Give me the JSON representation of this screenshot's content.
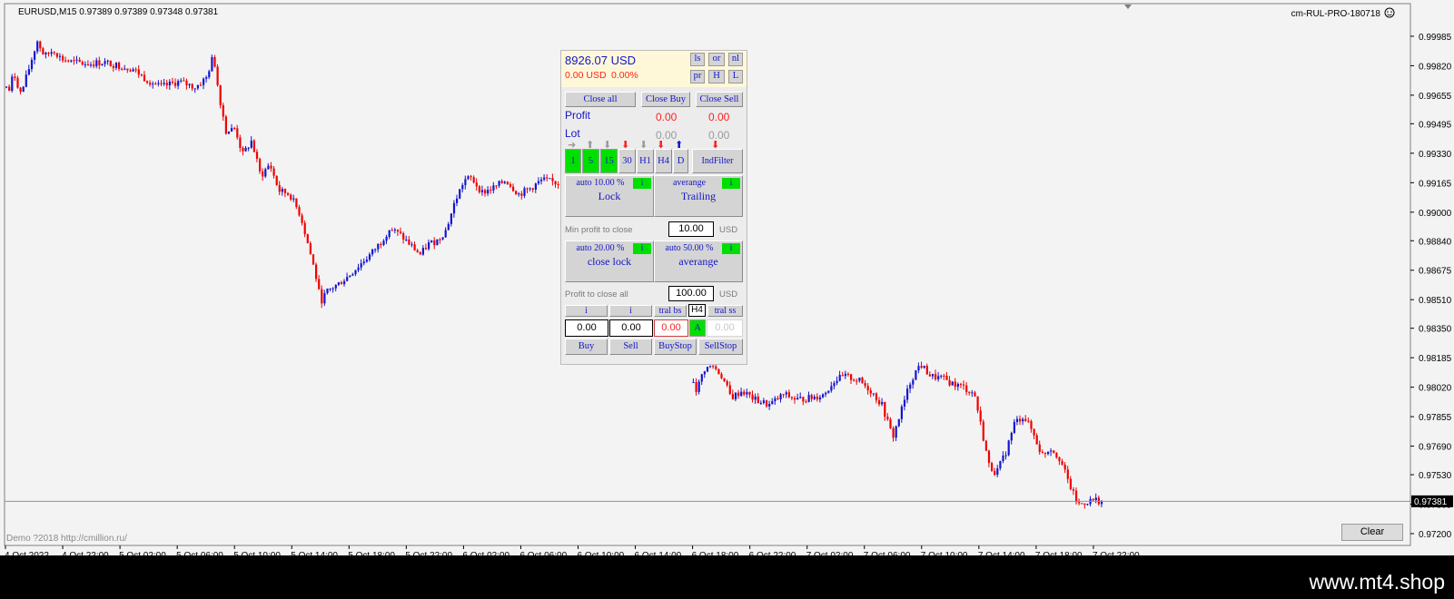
{
  "header": {
    "symbol_info": "EURUSD,M15  0.97389 0.97389 0.97348 0.97381",
    "indicator_name": "cm-RUL-PRO-180718"
  },
  "icons": {
    "smiley": "smiley-icon",
    "arrow_up": "arrow-up-icon",
    "arrow_down": "arrow-down-icon"
  },
  "colors": {
    "bull": "#1515d0",
    "bear": "#f00000",
    "panel_blue": "#1515c8",
    "active_green": "#00e000"
  },
  "chart_data": {
    "type": "candlestick",
    "symbol": "EURUSD",
    "timeframe": "M15",
    "ylim": [
      0.9721,
      1.0
    ],
    "y_ticks": [
      "0.99985",
      "0.99820",
      "0.99655",
      "0.99495",
      "0.99330",
      "0.99165",
      "0.99000",
      "0.98840",
      "0.98675",
      "0.98510",
      "0.98350",
      "0.98185",
      "0.98020",
      "0.97855",
      "0.97690",
      "0.97530",
      "0.97365",
      "0.97200"
    ],
    "x_ticks": [
      "4 Oct 2022",
      "4 Oct 22:00",
      "5 Oct 02:00",
      "5 Oct 06:00",
      "5 Oct 10:00",
      "5 Oct 14:00",
      "5 Oct 18:00",
      "5 Oct 22:00",
      "6 Oct 02:00",
      "6 Oct 06:00",
      "6 Oct 10:00",
      "6 Oct 14:00",
      "6 Oct 18:00",
      "6 Oct 22:00",
      "7 Oct 02:00",
      "7 Oct 06:00",
      "7 Oct 10:00",
      "7 Oct 14:00",
      "7 Oct 18:00",
      "7 Oct 22:00"
    ],
    "current_price": "0.97381",
    "price_path": [
      [
        0,
        0.9982
      ],
      [
        8,
        0.9966
      ],
      [
        14,
        0.9978
      ],
      [
        22,
        0.9966
      ],
      [
        30,
        0.9979
      ],
      [
        40,
        0.9996
      ],
      [
        48,
        0.9987
      ],
      [
        58,
        0.9991
      ],
      [
        66,
        0.9986
      ],
      [
        78,
        0.9984
      ],
      [
        96,
        0.9983
      ],
      [
        112,
        0.9984
      ],
      [
        130,
        0.9982
      ],
      [
        146,
        0.998
      ],
      [
        158,
        0.9975
      ],
      [
        176,
        0.997
      ],
      [
        196,
        0.9973
      ],
      [
        214,
        0.997
      ],
      [
        226,
        0.9975
      ],
      [
        234,
        0.9988
      ],
      [
        240,
        0.9966
      ],
      [
        248,
        0.9945
      ],
      [
        258,
        0.9947
      ],
      [
        266,
        0.9932
      ],
      [
        276,
        0.994
      ],
      [
        286,
        0.992
      ],
      [
        296,
        0.9927
      ],
      [
        306,
        0.9912
      ],
      [
        318,
        0.991
      ],
      [
        330,
        0.9898
      ],
      [
        340,
        0.9878
      ],
      [
        346,
        0.9866
      ],
      [
        352,
        0.985
      ],
      [
        360,
        0.9856
      ],
      [
        372,
        0.986
      ],
      [
        382,
        0.9864
      ],
      [
        394,
        0.987
      ],
      [
        406,
        0.9876
      ],
      [
        418,
        0.9883
      ],
      [
        428,
        0.9891
      ],
      [
        440,
        0.9887
      ],
      [
        452,
        0.9881
      ],
      [
        462,
        0.9876
      ],
      [
        470,
        0.9882
      ],
      [
        480,
        0.9884
      ],
      [
        490,
        0.989
      ],
      [
        500,
        0.9906
      ],
      [
        510,
        0.9918
      ],
      [
        518,
        0.9919
      ],
      [
        530,
        0.9911
      ],
      [
        544,
        0.9914
      ],
      [
        556,
        0.9918
      ],
      [
        570,
        0.991
      ],
      [
        582,
        0.9913
      ],
      [
        596,
        0.9918
      ],
      [
        616,
        0.9916
      ],
      [
        760,
        0.981
      ],
      [
        766,
        0.98
      ],
      [
        774,
        0.9812
      ],
      [
        784,
        0.9814
      ],
      [
        794,
        0.9808
      ],
      [
        804,
        0.9796
      ],
      [
        816,
        0.98
      ],
      [
        830,
        0.9795
      ],
      [
        846,
        0.9792
      ],
      [
        862,
        0.9798
      ],
      [
        876,
        0.9795
      ],
      [
        892,
        0.9796
      ],
      [
        906,
        0.9798
      ],
      [
        918,
        0.9806
      ],
      [
        930,
        0.9808
      ],
      [
        944,
        0.9806
      ],
      [
        958,
        0.98
      ],
      [
        970,
        0.9792
      ],
      [
        982,
        0.9774
      ],
      [
        992,
        0.979
      ],
      [
        1002,
        0.9806
      ],
      [
        1012,
        0.9815
      ],
      [
        1024,
        0.9808
      ],
      [
        1036,
        0.9807
      ],
      [
        1048,
        0.9804
      ],
      [
        1060,
        0.9802
      ],
      [
        1072,
        0.9798
      ],
      [
        1080,
        0.9778
      ],
      [
        1088,
        0.9758
      ],
      [
        1096,
        0.9754
      ],
      [
        1106,
        0.9765
      ],
      [
        1116,
        0.9782
      ],
      [
        1126,
        0.9786
      ],
      [
        1136,
        0.9777
      ],
      [
        1146,
        0.9764
      ],
      [
        1156,
        0.9768
      ],
      [
        1166,
        0.9762
      ],
      [
        1176,
        0.9748
      ],
      [
        1186,
        0.9736
      ],
      [
        1196,
        0.9738
      ],
      [
        1206,
        0.9739
      ],
      [
        1212,
        0.9738
      ]
    ]
  },
  "panel": {
    "balance": "8926.07 USD",
    "pl_usd": "0.00 USD",
    "pl_pct": "0.00%",
    "top_buttons": [
      "ls",
      "or",
      "nl",
      "pr",
      "H",
      "L"
    ],
    "close_all": "Close all",
    "close_buy": "Close Buy",
    "close_sell": "Close Sell",
    "profit_label": "Profit",
    "profit_buy": "0.00",
    "profit_sell": "0.00",
    "lot_label": "Lot",
    "lot_buy": "0.00",
    "lot_sell": "0.00",
    "timeframes": [
      "1",
      "5",
      "15",
      "30",
      "H1",
      "H4",
      "D"
    ],
    "ind_filter": "IndFilter",
    "lock_auto": "auto 10.00 %",
    "lock_label": "Lock",
    "trailing_mode": "averange",
    "trailing_label": "Trailing",
    "info": "i",
    "min_profit_label": "Min profit to close",
    "min_profit_value": "10.00",
    "currency": "USD",
    "close_lock_auto": "auto 20.00 %",
    "close_lock_label": "close lock",
    "averange_auto": "auto 50.00 %",
    "averange_label": "averange",
    "profit_all_label": "Profit to close all",
    "profit_all_value": "100.00",
    "tral_bs": "tral bs",
    "tral_tf": "H4",
    "tral_ss": "tral ss",
    "buy_lot": "0.00",
    "sell_lot": "0.00",
    "stop_value": "0.00",
    "auto_flag": "A",
    "stop_value2": "0.00",
    "buy": "Buy",
    "sell": "Sell",
    "buy_stop": "BuyStop",
    "sell_stop": "SellStop"
  },
  "footer": {
    "demo_text": "Demo ?2018 http://cmillion.ru/",
    "clear": "Clear",
    "brand": "www.mt4.shop"
  }
}
